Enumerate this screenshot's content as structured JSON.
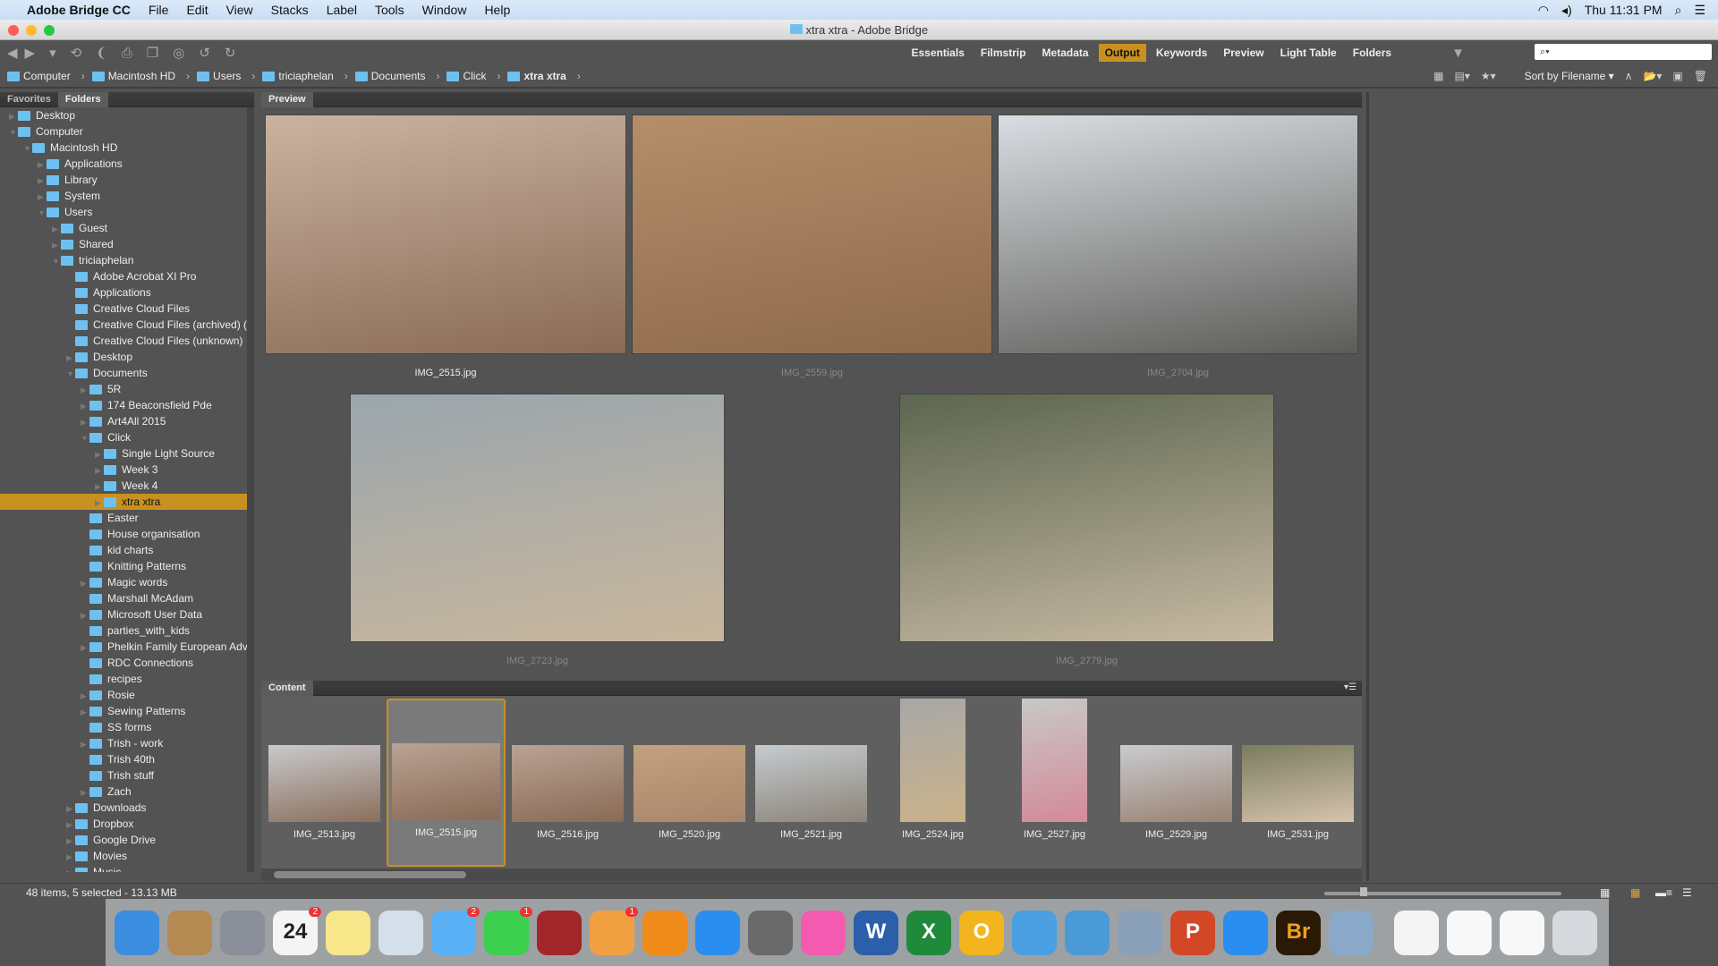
{
  "menubar": {
    "app": "Adobe Bridge CC",
    "items": [
      "File",
      "Edit",
      "View",
      "Stacks",
      "Label",
      "Tools",
      "Window",
      "Help"
    ],
    "clock": "Thu 11:31 PM"
  },
  "window": {
    "title": "xtra xtra - Adobe Bridge"
  },
  "workspaces": [
    {
      "label": "Essentials"
    },
    {
      "label": "Filmstrip"
    },
    {
      "label": "Metadata"
    },
    {
      "label": "Output",
      "active": true
    },
    {
      "label": "Keywords"
    },
    {
      "label": "Preview"
    },
    {
      "label": "Light Table"
    },
    {
      "label": "Folders"
    }
  ],
  "search": {
    "placeholder": "⌕▾"
  },
  "sort": {
    "label": "Sort by Filename ▾"
  },
  "breadcrumb": [
    "Computer",
    "Macintosh HD",
    "Users",
    "triciaphelan",
    "Documents",
    "Click",
    "xtra xtra"
  ],
  "left_tabs": [
    "Favorites",
    "Folders"
  ],
  "tree": [
    {
      "d": 0,
      "t": "c",
      "l": "Desktop"
    },
    {
      "d": 0,
      "t": "o",
      "l": "Computer"
    },
    {
      "d": 1,
      "t": "o",
      "l": "Macintosh HD"
    },
    {
      "d": 2,
      "t": "c",
      "l": "Applications"
    },
    {
      "d": 2,
      "t": "c",
      "l": "Library"
    },
    {
      "d": 2,
      "t": "c",
      "l": "System"
    },
    {
      "d": 2,
      "t": "o",
      "l": "Users"
    },
    {
      "d": 3,
      "t": "c",
      "l": "Guest"
    },
    {
      "d": 3,
      "t": "c",
      "l": "Shared"
    },
    {
      "d": 3,
      "t": "o",
      "l": "triciaphelan"
    },
    {
      "d": 4,
      "t": "",
      "l": "Adobe Acrobat XI Pro"
    },
    {
      "d": 4,
      "t": "",
      "l": "Applications"
    },
    {
      "d": 4,
      "t": "",
      "l": "Creative Cloud Files"
    },
    {
      "d": 4,
      "t": "",
      "l": "Creative Cloud Files (archived) ("
    },
    {
      "d": 4,
      "t": "",
      "l": "Creative Cloud Files (unknown)"
    },
    {
      "d": 4,
      "t": "c",
      "l": "Desktop"
    },
    {
      "d": 4,
      "t": "o",
      "l": "Documents"
    },
    {
      "d": 5,
      "t": "c",
      "l": "5R"
    },
    {
      "d": 5,
      "t": "c",
      "l": "174 Beaconsfield Pde"
    },
    {
      "d": 5,
      "t": "c",
      "l": "Art4All 2015"
    },
    {
      "d": 5,
      "t": "o",
      "l": "Click"
    },
    {
      "d": 6,
      "t": "c",
      "l": "Single Light Source"
    },
    {
      "d": 6,
      "t": "c",
      "l": "Week 3"
    },
    {
      "d": 6,
      "t": "c",
      "l": "Week 4"
    },
    {
      "d": 6,
      "t": "c",
      "l": "xtra xtra",
      "sel": true
    },
    {
      "d": 5,
      "t": "",
      "l": "Easter"
    },
    {
      "d": 5,
      "t": "",
      "l": "House organisation"
    },
    {
      "d": 5,
      "t": "",
      "l": "kid charts"
    },
    {
      "d": 5,
      "t": "",
      "l": "Knitting Patterns"
    },
    {
      "d": 5,
      "t": "c",
      "l": "Magic words"
    },
    {
      "d": 5,
      "t": "",
      "l": "Marshall McAdam"
    },
    {
      "d": 5,
      "t": "c",
      "l": "Microsoft User Data"
    },
    {
      "d": 5,
      "t": "",
      "l": "parties_with_kids"
    },
    {
      "d": 5,
      "t": "c",
      "l": "Phelkin Family European Adve"
    },
    {
      "d": 5,
      "t": "",
      "l": "RDC Connections"
    },
    {
      "d": 5,
      "t": "",
      "l": "recipes"
    },
    {
      "d": 5,
      "t": "c",
      "l": "Rosie"
    },
    {
      "d": 5,
      "t": "c",
      "l": "Sewing Patterns"
    },
    {
      "d": 5,
      "t": "",
      "l": "SS forms"
    },
    {
      "d": 5,
      "t": "c",
      "l": "Trish - work"
    },
    {
      "d": 5,
      "t": "",
      "l": "Trish 40th"
    },
    {
      "d": 5,
      "t": "",
      "l": "Trish stuff"
    },
    {
      "d": 5,
      "t": "c",
      "l": "Zach"
    },
    {
      "d": 4,
      "t": "c",
      "l": "Downloads"
    },
    {
      "d": 4,
      "t": "c",
      "l": "Dropbox"
    },
    {
      "d": 4,
      "t": "c",
      "l": "Google Drive"
    },
    {
      "d": 4,
      "t": "c",
      "l": "Movies"
    },
    {
      "d": 4,
      "t": "c",
      "l": "Music"
    }
  ],
  "preview": {
    "tab": "Preview",
    "images": [
      {
        "name": "IMG_2515.jpg",
        "colors": [
          "#c9b3a0",
          "#8a6a55"
        ],
        "active": true
      },
      {
        "name": "IMG_2559.jpg",
        "colors": [
          "#b58d6a",
          "#8d6a4c"
        ]
      },
      {
        "name": "IMG_2704.jpg",
        "colors": [
          "#d8dde2",
          "#5d5c58"
        ]
      },
      {
        "name": "IMG_2723.jpg",
        "colors": [
          "#9aa6ad",
          "#c9b69c"
        ]
      },
      {
        "name": "IMG_2779.jpg",
        "colors": [
          "#5c6650",
          "#c7b9a3"
        ]
      }
    ]
  },
  "content": {
    "tab": "Content",
    "items": [
      {
        "name": "IMG_2513.jpg",
        "colors": [
          "#c9c9cc",
          "#8a6f5c"
        ],
        "portrait": false
      },
      {
        "name": "IMG_2515.jpg",
        "colors": [
          "#b9a393",
          "#8a6a55"
        ],
        "portrait": false,
        "selected": true
      },
      {
        "name": "IMG_2516.jpg",
        "colors": [
          "#b9a393",
          "#8a6a55"
        ],
        "portrait": false
      },
      {
        "name": "IMG_2520.jpg",
        "colors": [
          "#c2a27f",
          "#a9866a"
        ],
        "portrait": false
      },
      {
        "name": "IMG_2521.jpg",
        "colors": [
          "#c5cbd0",
          "#8c8478"
        ],
        "portrait": false
      },
      {
        "name": "IMG_2524.jpg",
        "colors": [
          "#a9a8a6",
          "#c9b28a"
        ],
        "portrait": true
      },
      {
        "name": "IMG_2527.jpg",
        "colors": [
          "#c8c8c6",
          "#d38a9a"
        ],
        "portrait": true
      },
      {
        "name": "IMG_2529.jpg",
        "colors": [
          "#c9cbcf",
          "#9a8272"
        ],
        "portrait": false
      },
      {
        "name": "IMG_2531.jpg",
        "colors": [
          "#7a7c5f",
          "#d6c3ad"
        ],
        "portrait": false
      }
    ]
  },
  "status": {
    "text": "48 items, 5 selected - 13.13 MB"
  },
  "dock": [
    {
      "icon": "finder-icon",
      "color": "#3b8de0"
    },
    {
      "icon": "contacts-icon",
      "color": "#b48a52"
    },
    {
      "icon": "launchpad-icon",
      "color": "#8a8f9a"
    },
    {
      "icon": "calendar-icon",
      "color": "#f4f4f4",
      "badge": "2",
      "text": "24"
    },
    {
      "icon": "notes-icon",
      "color": "#f7e68a"
    },
    {
      "icon": "preview-icon",
      "color": "#d4dfe9"
    },
    {
      "icon": "messages-icon",
      "color": "#5ab0f5",
      "badge": "2"
    },
    {
      "icon": "facetime-icon",
      "color": "#3ccf4e",
      "badge": "1"
    },
    {
      "icon": "photo-booth-icon",
      "color": "#a0262a"
    },
    {
      "icon": "photos-icon",
      "color": "#f0a040",
      "badge": "1"
    },
    {
      "icon": "ibooks-icon",
      "color": "#f08a1a"
    },
    {
      "icon": "app-store-icon",
      "color": "#2a8ef0"
    },
    {
      "icon": "system-preferences-icon",
      "color": "#6a6a6a"
    },
    {
      "icon": "itunes-icon",
      "color": "#f45ab0"
    },
    {
      "icon": "word-icon",
      "color": "#2b5faa",
      "text": "W"
    },
    {
      "icon": "excel-icon",
      "color": "#1f8a3a",
      "text": "X"
    },
    {
      "icon": "outlook-icon",
      "color": "#f2b51d",
      "text": "O"
    },
    {
      "icon": "messenger-icon",
      "color": "#4aa0e0"
    },
    {
      "icon": "downloader-icon",
      "color": "#4a9ad8"
    },
    {
      "icon": "network-icon",
      "color": "#8aa0b8"
    },
    {
      "icon": "powerpoint-icon",
      "color": "#d24726",
      "text": "P"
    },
    {
      "icon": "safari-icon",
      "color": "#2a8ef0"
    },
    {
      "icon": "bridge-icon",
      "color": "#2a1a05",
      "text": "Br"
    },
    {
      "icon": "image-capture-icon",
      "color": "#8aa8c8"
    },
    {
      "icon": "document-icon",
      "color": "#f4f4f4"
    },
    {
      "icon": "window-icon",
      "color": "#f8f8f8"
    },
    {
      "icon": "window-icon-2",
      "color": "#f8f8f8"
    },
    {
      "icon": "trash-icon",
      "color": "#d6dade"
    }
  ]
}
